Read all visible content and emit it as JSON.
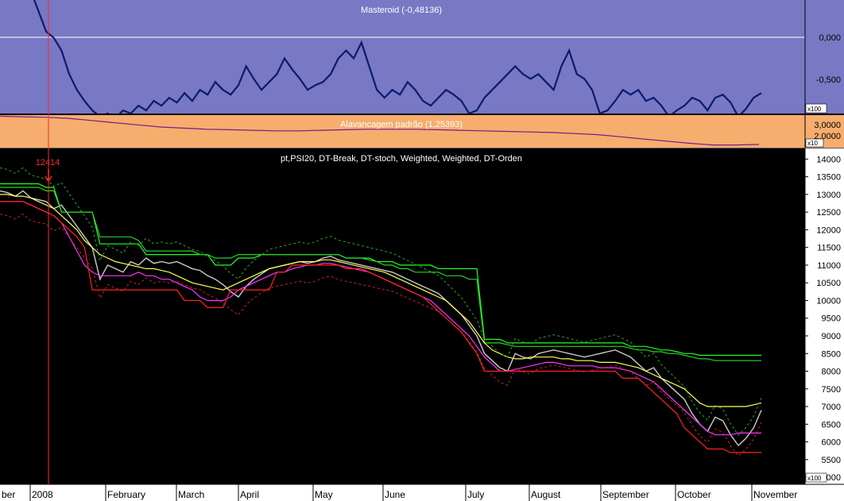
{
  "panels": {
    "oscillator": {
      "title": "Masteroid (-0,48136)",
      "unit_label": "x100",
      "bg": "#7878c4",
      "line_color": "#0b1a6e",
      "ticks": [
        "0,000",
        "-0,500"
      ]
    },
    "leverage": {
      "title": "Alavancagem padrão (1,25393)",
      "unit_label": "x10",
      "bg": "#f6ad6e",
      "line_color": "#7a1a8a",
      "ticks": [
        "3,0000",
        "2,0000"
      ]
    },
    "price": {
      "title": "pt,PSI20, DT-Break, DT-stoch, Weighted, Weighted, DT-Orden",
      "unit_label": "x100",
      "bg": "#000000",
      "ticks": [
        "14000",
        "13500",
        "13000",
        "12500",
        "12000",
        "11500",
        "11000",
        "10500",
        "10000",
        "9500",
        "9000",
        "8500",
        "8000",
        "7500",
        "7000",
        "6500",
        "6000",
        "5500",
        "5000"
      ],
      "marker_label": "12414",
      "marker_color": "#ff2a2a"
    }
  },
  "x_axis": {
    "labels": [
      "ber",
      "2008",
      "February",
      "March",
      "April",
      "May",
      "June",
      "July",
      "August",
      "September",
      "October",
      "November"
    ]
  },
  "colors": {
    "axis_bg": "#ffffff",
    "axis_text": "#000000",
    "price_text": "#ffffff"
  },
  "chart_data": [
    {
      "type": "line",
      "title": "Masteroid (-0,48136)",
      "ylim": [
        -0.6,
        0.12
      ],
      "series": [
        {
          "name": "Masteroid",
          "values": [
            0.22,
            0.28,
            0.2,
            0.3,
            0.18,
            0.05,
            -0.08,
            -0.12,
            -0.2,
            -0.35,
            -0.45,
            -0.52,
            -0.58,
            -0.62,
            -0.6,
            -0.63,
            -0.58,
            -0.6,
            -0.55,
            -0.58,
            -0.52,
            -0.55,
            -0.5,
            -0.53,
            -0.47,
            -0.52,
            -0.45,
            -0.48,
            -0.4,
            -0.45,
            -0.48,
            -0.42,
            -0.3,
            -0.38,
            -0.45,
            -0.4,
            -0.35,
            -0.25,
            -0.32,
            -0.38,
            -0.45,
            -0.42,
            -0.4,
            -0.35,
            -0.25,
            -0.2,
            -0.25,
            -0.15,
            -0.3,
            -0.45,
            -0.5,
            -0.45,
            -0.48,
            -0.4,
            -0.45,
            -0.52,
            -0.55,
            -0.5,
            -0.45,
            -0.48,
            -0.52,
            -0.6,
            -0.58,
            -0.5,
            -0.45,
            -0.4,
            -0.35,
            -0.3,
            -0.35,
            -0.38,
            -0.35,
            -0.4,
            -0.45,
            -0.3,
            -0.2,
            -0.35,
            -0.38,
            -0.45,
            -0.6,
            -0.58,
            -0.52,
            -0.45,
            -0.48,
            -0.45,
            -0.52,
            -0.5,
            -0.55,
            -0.62,
            -0.58,
            -0.55,
            -0.5,
            -0.52,
            -0.58,
            -0.5,
            -0.48,
            -0.53,
            -0.62,
            -0.57,
            -0.5,
            -0.47
          ]
        }
      ]
    },
    {
      "type": "line",
      "title": "Alavancagem padrão (1,25393)",
      "ylim": [
        1.0,
        4.0
      ],
      "series": [
        {
          "name": "Alavancagem padrão",
          "values": [
            3.9,
            3.85,
            3.8,
            3.7,
            3.5,
            3.3,
            3.1,
            2.9,
            2.8,
            2.7,
            2.65,
            2.6,
            2.55,
            2.55,
            2.6,
            2.65,
            2.7,
            2.7,
            2.7,
            2.65,
            2.6,
            2.55,
            2.5,
            2.45,
            2.4,
            2.3,
            2.2,
            2.0,
            1.8,
            1.6,
            1.4,
            1.25,
            1.25,
            1.3
          ]
        }
      ]
    },
    {
      "type": "line",
      "title": "pt,PSI20, DT-Break, DT-stoch, Weighted, Weighted, DT-Orden",
      "ylim": [
        4800,
        14300
      ],
      "x": [
        "ber",
        "2008",
        "February",
        "March",
        "April",
        "May",
        "June",
        "July",
        "August",
        "September",
        "October",
        "November"
      ],
      "series": [
        {
          "name": "PSI20",
          "color": "#cccccc",
          "values": [
            13100,
            13050,
            12950,
            13100,
            12900,
            12850,
            12800,
            12600,
            12700,
            12400,
            12100,
            11800,
            11500,
            10600,
            11000,
            10900,
            10800,
            11100,
            11000,
            11200,
            11050,
            11100,
            11050,
            11100,
            11000,
            10900,
            10850,
            10700,
            10600,
            10450,
            10250,
            10100,
            10400,
            10600,
            10750,
            10900,
            10950,
            11000,
            11050,
            11100,
            11050,
            11100,
            11200,
            11250,
            11150,
            11100,
            11050,
            11000,
            10950,
            10900,
            10850,
            10800,
            10700,
            10600,
            10500,
            10400,
            10300,
            10200,
            10000,
            9800,
            9600,
            9300,
            9000,
            8500,
            8300,
            8100,
            8000,
            8500,
            8400,
            8350,
            8500,
            8550,
            8600,
            8550,
            8500,
            8450,
            8400,
            8450,
            8500,
            8550,
            8600,
            8500,
            8400,
            8200,
            8000,
            8100,
            7800,
            7600,
            7400,
            7200,
            6800,
            6500,
            6300,
            6700,
            6600,
            6200,
            5900,
            6100,
            6400,
            6900
          ]
        },
        {
          "name": "Upper band (green)",
          "color": "#22ff22",
          "values": [
            13300,
            13300,
            13300,
            13300,
            13300,
            13300,
            13200,
            13200,
            12500,
            12500,
            12500,
            12500,
            12500,
            11600,
            11600,
            11600,
            11600,
            11600,
            11600,
            11300,
            11300,
            11300,
            11300,
            11300,
            11300,
            11300,
            11300,
            11300,
            11000,
            11000,
            11000,
            11200,
            11200,
            11200,
            11300,
            11300,
            11300,
            11300,
            11300,
            11300,
            11300,
            11300,
            11300,
            11300,
            11300,
            11200,
            11200,
            11200,
            11200,
            11100,
            11100,
            11100,
            11000,
            11000,
            11000,
            11000,
            11000,
            10900,
            10900,
            10900,
            10900,
            10900,
            10900,
            8900,
            8900,
            8900,
            8800,
            8800,
            8800,
            8800,
            8800,
            8800,
            8800,
            8800,
            8800,
            8800,
            8800,
            8800,
            8800,
            8800,
            8800,
            8800,
            8700,
            8700,
            8700,
            8650,
            8600,
            8600,
            8550,
            8500,
            8500,
            8450,
            8450,
            8450,
            8450,
            8450,
            8450,
            8450,
            8450,
            8450
          ]
        },
        {
          "name": "Upper band 2 (green)",
          "color": "#2bd12b",
          "values": [
            13200,
            13200,
            13200,
            13200,
            13200,
            13200,
            13100,
            13100,
            12500,
            12500,
            12500,
            12500,
            12500,
            11800,
            11800,
            11800,
            11800,
            11800,
            11700,
            11400,
            11400,
            11400,
            11400,
            11400,
            11400,
            11400,
            11300,
            11300,
            11200,
            11200,
            11200,
            11300,
            11300,
            11300,
            11300,
            11300,
            11300,
            11300,
            11300,
            11300,
            11300,
            11300,
            11300,
            11300,
            11300,
            11200,
            11200,
            11200,
            11150,
            11100,
            11000,
            11000,
            10900,
            10900,
            10800,
            10800,
            10800,
            10800,
            10700,
            10700,
            10700,
            10600,
            10600,
            8800,
            8800,
            8800,
            8750,
            8700,
            8700,
            8700,
            8700,
            8700,
            8700,
            8700,
            8700,
            8700,
            8700,
            8700,
            8700,
            8700,
            8700,
            8700,
            8650,
            8600,
            8600,
            8550,
            8550,
            8500,
            8500,
            8450,
            8400,
            8350,
            8350,
            8300,
            8300,
            8300,
            8300,
            8300,
            8300,
            8300
          ]
        },
        {
          "name": "Weighted (yellow)",
          "color": "#ffff55",
          "values": [
            13000,
            13000,
            12950,
            12950,
            12900,
            12800,
            12700,
            12600,
            12400,
            12200,
            12000,
            11700,
            11500,
            11300,
            11200,
            11100,
            11050,
            11000,
            10950,
            10900,
            10900,
            10850,
            10800,
            10700,
            10600,
            10500,
            10450,
            10400,
            10350,
            10300,
            10400,
            10500,
            10600,
            10700,
            10800,
            10900,
            10950,
            11000,
            11050,
            11100,
            11100,
            11100,
            11150,
            11150,
            11100,
            11050,
            11000,
            10950,
            10900,
            10850,
            10800,
            10700,
            10600,
            10500,
            10400,
            10300,
            10200,
            10100,
            10000,
            9800,
            9600,
            9400,
            9100,
            8800,
            8600,
            8500,
            8400,
            8350,
            8350,
            8400,
            8400,
            8400,
            8400,
            8350,
            8350,
            8300,
            8300,
            8300,
            8250,
            8250,
            8250,
            8200,
            8150,
            8100,
            8000,
            7900,
            7800,
            7700,
            7600,
            7500,
            7300,
            7100,
            7000,
            7000,
            7000,
            7000,
            7000,
            7000,
            7050,
            7100
          ]
        },
        {
          "name": "DT-Orden (magenta)",
          "color": "#ff33ff",
          "values": [
            12800,
            12800,
            12800,
            12800,
            12700,
            12600,
            12500,
            12400,
            12200,
            11800,
            11400,
            11000,
            10800,
            10700,
            10700,
            10700,
            10700,
            10700,
            10800,
            10700,
            10700,
            10600,
            10600,
            10500,
            10400,
            10300,
            10100,
            10000,
            10000,
            10000,
            10100,
            10300,
            10400,
            10500,
            10600,
            10700,
            10800,
            10800,
            10900,
            10950,
            11000,
            11000,
            11050,
            11050,
            11000,
            10950,
            10900,
            10850,
            10800,
            10700,
            10600,
            10500,
            10400,
            10300,
            10200,
            10100,
            10000,
            9800,
            9600,
            9400,
            9200,
            9000,
            8700,
            8400,
            8200,
            8000,
            8000,
            8050,
            8100,
            8150,
            8200,
            8250,
            8250,
            8200,
            8150,
            8150,
            8150,
            8150,
            8100,
            8100,
            8100,
            8050,
            8000,
            7900,
            7800,
            7700,
            7500,
            7300,
            7100,
            6900,
            6700,
            6500,
            6300,
            6200,
            6200,
            6200,
            6250,
            6250,
            6250,
            6250
          ]
        },
        {
          "name": "DT-Break (red)",
          "color": "#ff2222",
          "values": [
            12800,
            12800,
            12800,
            12800,
            12700,
            12600,
            12500,
            12400,
            12200,
            12000,
            11800,
            11500,
            10300,
            10300,
            10300,
            10300,
            10300,
            10300,
            10300,
            10300,
            10300,
            10300,
            10300,
            10300,
            10000,
            10000,
            10000,
            9800,
            9800,
            9800,
            10300,
            10300,
            10300,
            10300,
            10300,
            10300,
            10800,
            10800,
            11000,
            11000,
            11000,
            11000,
            11000,
            11000,
            11000,
            10900,
            10900,
            10900,
            10800,
            10700,
            10600,
            10500,
            10400,
            10300,
            10200,
            10100,
            9900,
            9700,
            9500,
            9300,
            9100,
            8800,
            8500,
            8000,
            8000,
            8000,
            8000,
            8000,
            8000,
            8000,
            8000,
            8000,
            8000,
            8000,
            8000,
            8000,
            8000,
            8000,
            8000,
            8000,
            8000,
            7800,
            7800,
            7800,
            7600,
            7400,
            7200,
            7000,
            6800,
            6400,
            6200,
            6000,
            5800,
            5800,
            5800,
            5700,
            5700,
            5700,
            5700,
            5700
          ]
        }
      ]
    }
  ]
}
